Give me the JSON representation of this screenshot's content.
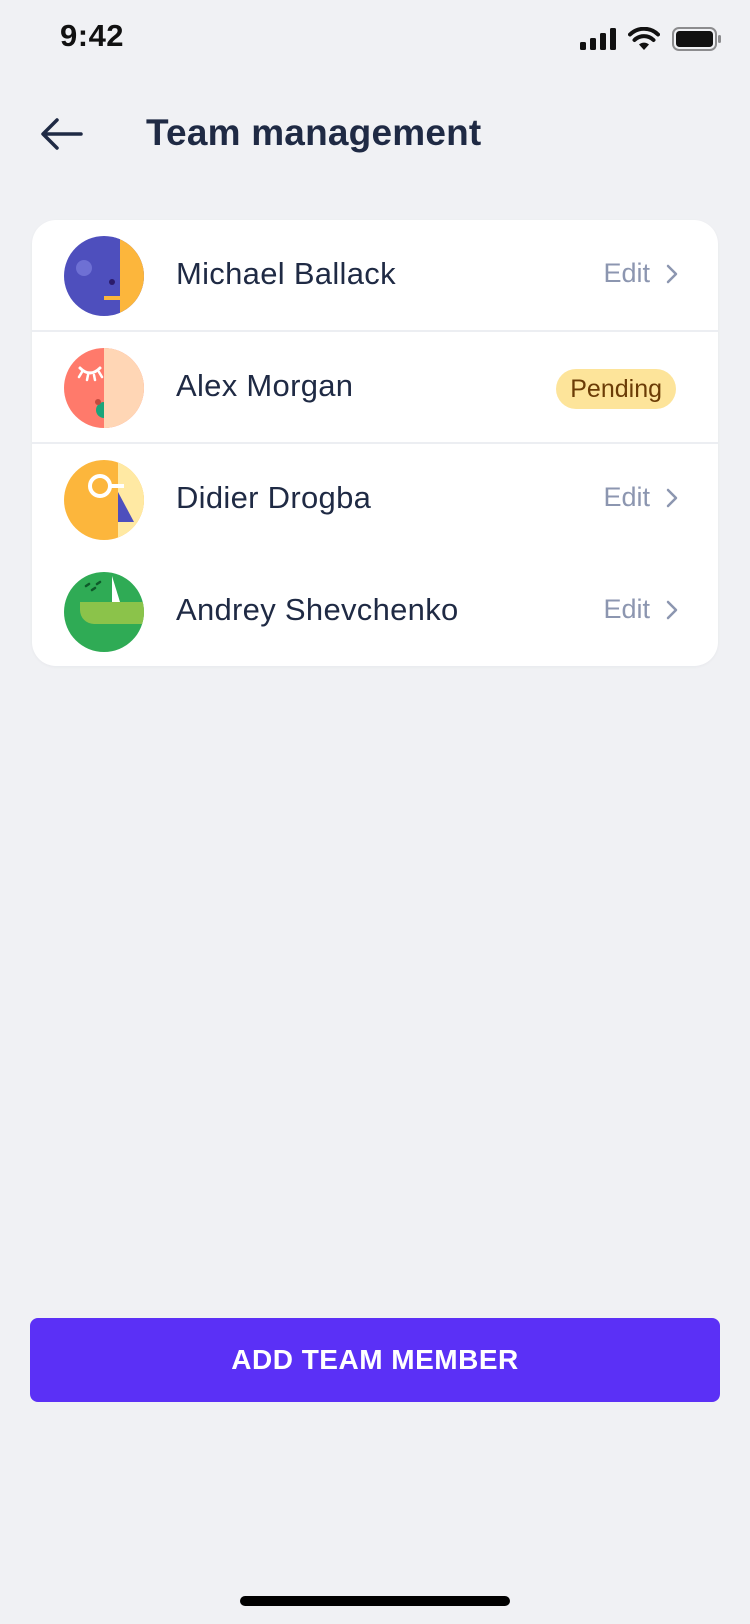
{
  "status_bar": {
    "time": "9:42",
    "icons": [
      "signal-icon",
      "wifi-icon",
      "battery-icon"
    ]
  },
  "header": {
    "back_icon": "arrow-left-icon",
    "title": "Team management"
  },
  "members": [
    {
      "name": "Michael Ballack",
      "action": "Edit",
      "avatar": "avatar-blue"
    },
    {
      "name": "Alex Morgan",
      "badge": "Pending",
      "avatar": "avatar-coral"
    },
    {
      "name": "Didier Drogba",
      "action": "Edit",
      "avatar": "avatar-orange"
    },
    {
      "name": "Andrey Shevchenko",
      "action": "Edit",
      "avatar": "avatar-green"
    }
  ],
  "add_button": {
    "label": "ADD TEAM MEMBER"
  },
  "colors": {
    "background": "#f0f1f4",
    "accent": "#5b30f6",
    "pending_badge": "#fde49a",
    "text_primary": "#1f2a44",
    "text_muted": "#8c96b0"
  }
}
